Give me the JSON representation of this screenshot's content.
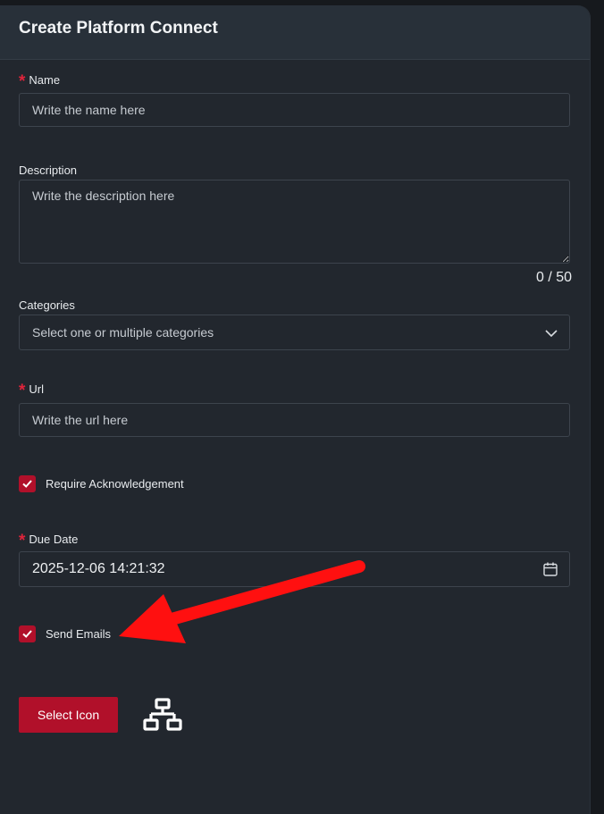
{
  "form": {
    "title": "Create Platform Connect",
    "required_marker": "*",
    "name": {
      "label": "Name",
      "placeholder": "Write the name here",
      "value": ""
    },
    "description": {
      "label": "Description",
      "placeholder": "Write the description here",
      "value": "",
      "counter": "0 / 50"
    },
    "categories": {
      "label": "Categories",
      "placeholder": "Select one or multiple categories"
    },
    "url": {
      "label": "Url",
      "placeholder": "Write the url here",
      "value": ""
    },
    "require_ack": {
      "label": "Require Acknowledgement",
      "checked": true
    },
    "due_date": {
      "label": "Due Date",
      "value": "2025-12-06 14:21:32"
    },
    "send_emails": {
      "label": "Send Emails",
      "checked": true
    },
    "select_icon_button": "Select Icon",
    "selected_icon": "network-hierarchy-icon"
  },
  "colors": {
    "accent": "#b1102a",
    "required": "#e0243b",
    "panel_bg": "#22272e",
    "header_bg": "#283039",
    "annotation_arrow": "#ff1010"
  }
}
